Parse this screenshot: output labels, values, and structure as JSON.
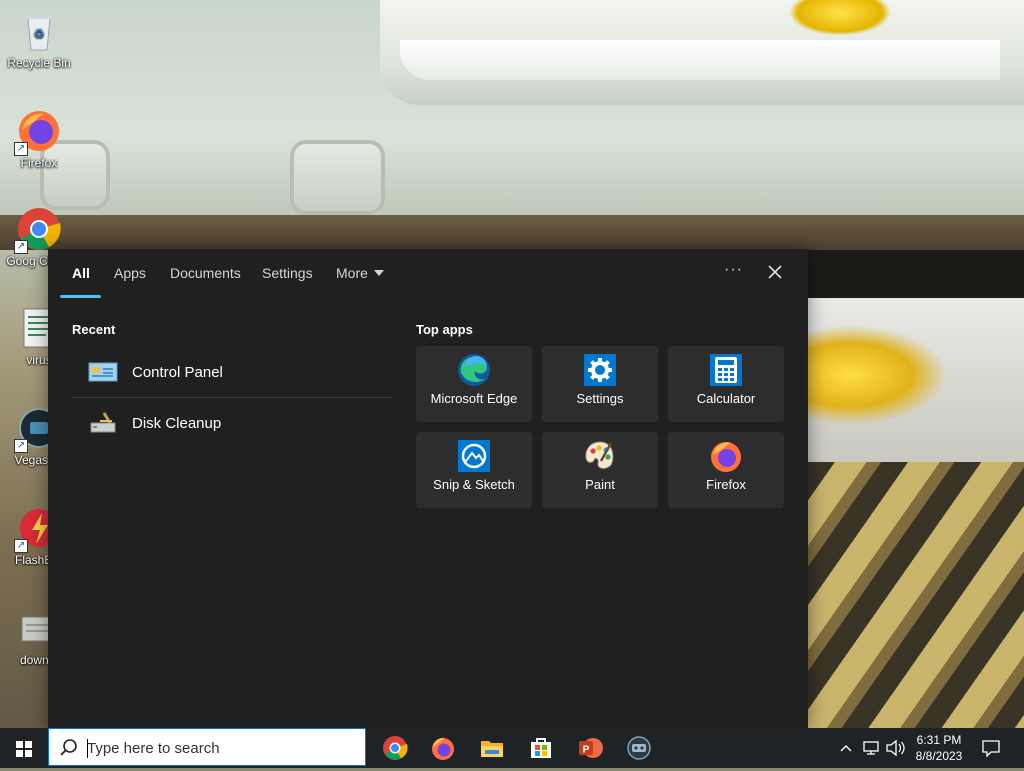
{
  "desktop": {
    "icons": [
      {
        "label": "Recycle Bin"
      },
      {
        "label": "Firefox"
      },
      {
        "label": "Goog Chron"
      },
      {
        "label": "virus"
      },
      {
        "label": "Vegas Pr"
      },
      {
        "label": "FlashBro"
      },
      {
        "label": "downlo"
      }
    ]
  },
  "search_panel": {
    "tabs": [
      "All",
      "Apps",
      "Documents",
      "Settings",
      "More"
    ],
    "active_tab": "All",
    "more_options_label": "···",
    "recent": {
      "heading": "Recent",
      "items": [
        {
          "label": "Control Panel",
          "icon": "control-panel-icon"
        },
        {
          "label": "Disk Cleanup",
          "icon": "disk-cleanup-icon"
        }
      ]
    },
    "top_apps": {
      "heading": "Top apps",
      "items": [
        {
          "label": "Microsoft Edge",
          "icon": "edge-icon"
        },
        {
          "label": "Settings",
          "icon": "gear-icon"
        },
        {
          "label": "Calculator",
          "icon": "calculator-icon"
        },
        {
          "label": "Snip & Sketch",
          "icon": "snip-sketch-icon"
        },
        {
          "label": "Paint",
          "icon": "paint-icon"
        },
        {
          "label": "Firefox",
          "icon": "firefox-icon"
        }
      ]
    }
  },
  "taskbar": {
    "search_placeholder": "Type here to search",
    "pinned": [
      "chrome-icon",
      "firefox-icon",
      "file-explorer-icon",
      "store-icon",
      "powerpoint-icon",
      "app-icon"
    ],
    "clock": {
      "time": "6:31 PM",
      "date": "8/8/2023"
    }
  },
  "colors": {
    "panel_bg": "#202020",
    "tile_bg": "#2d2d2d",
    "accent": "#4cc2ff",
    "taskbar_bg": "#1f2326"
  }
}
